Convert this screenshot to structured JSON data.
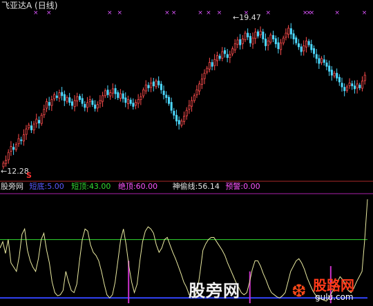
{
  "title": "飞亚达A (日线)",
  "price_labels": {
    "high": "19.47",
    "low": "12.28",
    "signal": "S"
  },
  "indicator": {
    "name": "股旁网",
    "items": [
      {
        "label": "短底:",
        "value": "5.00",
        "color": "#5a5aff"
      },
      {
        "label": "短顶:",
        "value": "43.00",
        "color": "#33dd33"
      },
      {
        "label": "绝顶:",
        "value": "60.00",
        "color": "#ff55ff"
      },
      {
        "label": "神偷线:",
        "value": "56.14",
        "color": "#e6e6e6"
      },
      {
        "label": "预警:",
        "value": "0.00",
        "color": "#ff55ff"
      }
    ]
  },
  "watermark": {
    "text1": "股旁网",
    "text2": "股路网",
    "text3": "gulu.com"
  },
  "chart_data": [
    {
      "type": "candlestick",
      "title": "飞亚达A (日线)",
      "period": "daily",
      "high_marker": 19.47,
      "low_marker": 12.28,
      "ylim": [
        11.6,
        20.2
      ],
      "up_color": "#ff4d4d",
      "down_color": "#4dd9ff",
      "close": [
        12.35,
        12.5,
        12.9,
        13.2,
        13.05,
        13.3,
        13.6,
        13.5,
        13.8,
        14.1,
        14.3,
        14.05,
        14.35,
        14.6,
        14.4,
        14.8,
        15.1,
        15.5,
        15.3,
        15.6,
        15.85,
        15.7,
        15.95,
        15.8,
        15.55,
        15.7,
        15.45,
        15.3,
        15.55,
        15.75,
        15.6,
        15.4,
        15.2,
        15.45,
        15.6,
        15.35,
        15.15,
        15.35,
        15.55,
        15.8,
        16.05,
        15.85,
        15.95,
        16.15,
        15.9,
        15.7,
        15.9,
        15.65,
        15.45,
        15.6,
        15.4,
        15.25,
        15.45,
        15.6,
        15.75,
        16.1,
        16.35,
        16.2,
        16.45,
        16.3,
        16.55,
        16.35,
        16.1,
        15.85,
        15.7,
        15.4,
        15.05,
        14.8,
        14.5,
        14.35,
        14.5,
        14.75,
        15.05,
        15.3,
        15.55,
        15.8,
        16.1,
        16.4,
        16.65,
        16.95,
        17.2,
        17.5,
        17.3,
        17.65,
        17.85,
        17.7,
        18.05,
        17.95,
        17.75,
        17.9,
        18.2,
        18.45,
        18.65,
        18.4,
        18.7,
        19.0,
        18.8,
        18.5,
        18.75,
        19.05,
        18.85,
        19.1,
        18.7,
        18.35,
        18.6,
        18.9,
        18.7,
        18.45,
        18.2,
        18.5,
        18.75,
        19.0,
        19.25,
        18.95,
        18.7,
        18.5,
        18.3,
        18.05,
        18.35,
        18.6,
        18.4,
        18.15,
        17.95,
        17.7,
        17.45,
        17.7,
        17.5,
        17.3,
        17.05,
        16.85,
        16.95,
        16.7,
        16.5,
        16.25,
        16.05,
        16.25,
        16.45,
        16.3,
        16.15,
        16.4,
        16.2,
        16.55,
        16.85
      ]
    },
    {
      "type": "line",
      "name": "股旁网",
      "ylim": [
        0,
        100
      ],
      "levels": {
        "短底": 5,
        "短顶": 43,
        "绝顶": 60
      },
      "series": [
        {
          "name": "神偷线",
          "color": "#eaeaa0",
          "values": [
            52,
            58,
            47,
            60,
            38,
            34,
            30,
            44,
            65,
            70,
            50,
            40,
            34,
            30,
            42,
            60,
            66,
            50,
            38,
            20,
            10,
            7,
            8,
            12,
            30,
            20,
            12,
            10,
            18,
            40,
            60,
            70,
            68,
            55,
            48,
            45,
            40,
            30,
            18,
            8,
            5,
            8,
            20,
            40,
            60,
            70,
            55,
            35,
            20,
            10,
            18,
            40,
            58,
            68,
            72,
            70,
            66,
            55,
            48,
            52,
            60,
            62,
            55,
            48,
            42,
            35,
            28,
            20,
            15,
            8,
            6,
            6,
            12,
            30,
            50,
            56,
            60,
            62,
            62,
            58,
            54,
            50,
            45,
            38,
            32,
            26,
            20,
            15,
            10,
            8,
            10,
            20,
            32,
            40,
            40,
            35,
            28,
            22,
            15,
            10,
            8,
            6,
            5,
            7,
            10,
            20,
            30,
            35,
            40,
            42,
            38,
            32,
            24,
            18,
            12,
            8,
            5,
            4,
            3,
            2,
            5,
            10,
            15,
            20,
            25,
            22,
            18,
            12,
            10,
            14,
            20,
            25,
            30,
            60,
            98
          ]
        }
      ]
    }
  ]
}
